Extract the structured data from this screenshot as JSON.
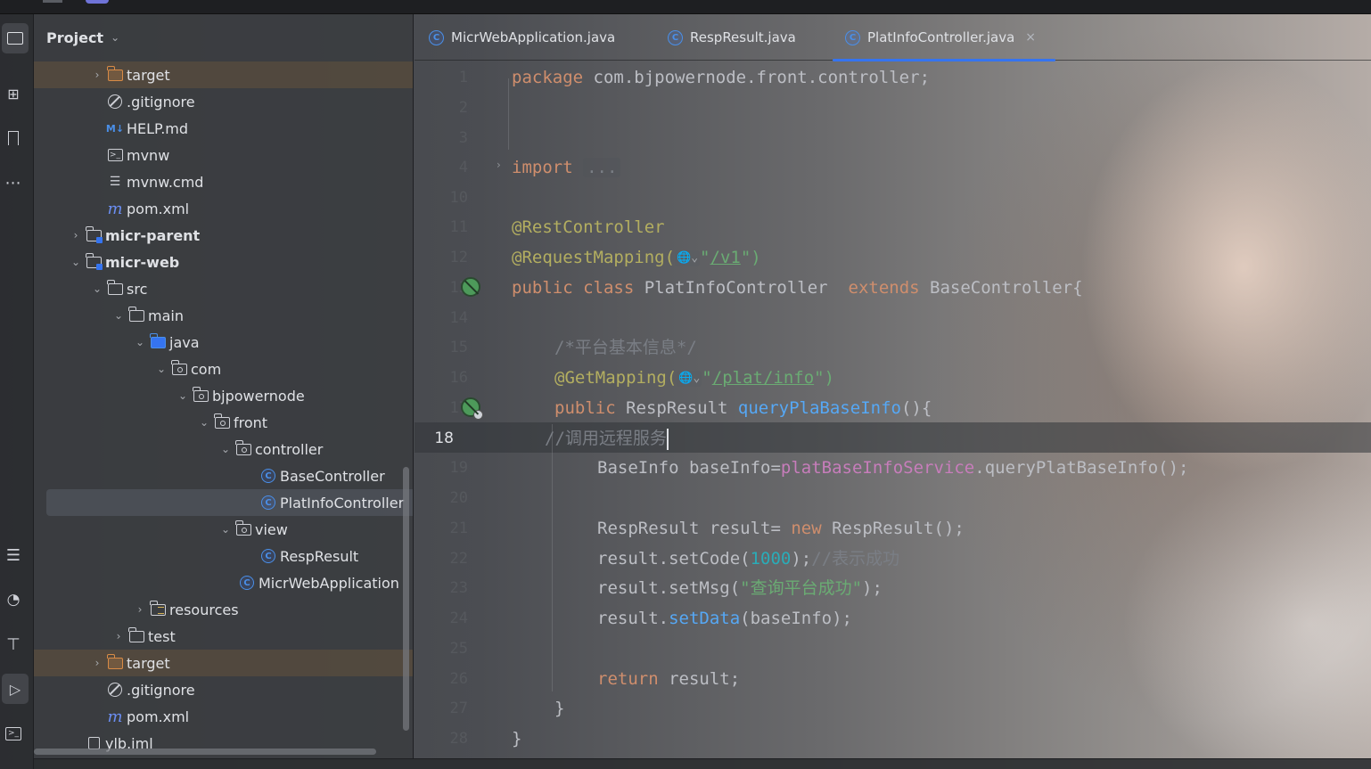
{
  "project_panel": {
    "title": "Project",
    "tree": [
      {
        "label": "target",
        "icon": "folder-excluded-icon"
      },
      {
        "label": ".gitignore",
        "icon": "ignore-file-icon"
      },
      {
        "label": "HELP.md",
        "icon": "markdown-icon"
      },
      {
        "label": "mvnw",
        "icon": "terminal-file-icon"
      },
      {
        "label": "mvnw.cmd",
        "icon": "text-file-icon"
      },
      {
        "label": "pom.xml",
        "icon": "maven-icon"
      },
      {
        "label": "micr-parent",
        "icon": "module-folder-icon"
      },
      {
        "label": "micr-web",
        "icon": "module-folder-icon"
      },
      {
        "label": "src",
        "icon": "folder-icon"
      },
      {
        "label": "main",
        "icon": "folder-icon"
      },
      {
        "label": "java",
        "icon": "source-folder-icon"
      },
      {
        "label": "com",
        "icon": "package-icon"
      },
      {
        "label": "bjpowernode",
        "icon": "package-icon"
      },
      {
        "label": "front",
        "icon": "package-icon"
      },
      {
        "label": "controller",
        "icon": "package-icon"
      },
      {
        "label": "BaseController",
        "icon": "class-icon"
      },
      {
        "label": "PlatInfoController",
        "icon": "class-icon"
      },
      {
        "label": "view",
        "icon": "package-icon"
      },
      {
        "label": "RespResult",
        "icon": "class-icon"
      },
      {
        "label": "MicrWebApplication",
        "icon": "spring-boot-class-icon"
      },
      {
        "label": "resources",
        "icon": "resources-folder-icon"
      },
      {
        "label": "test",
        "icon": "folder-icon"
      },
      {
        "label": "target",
        "icon": "folder-excluded-icon"
      },
      {
        "label": ".gitignore",
        "icon": "ignore-file-icon"
      },
      {
        "label": "pom.xml",
        "icon": "maven-icon"
      },
      {
        "label": "ylb.iml",
        "icon": "iml-file-icon"
      }
    ]
  },
  "tabs": [
    {
      "label": "MicrWebApplication.java",
      "icon": "spring-boot-class-icon"
    },
    {
      "label": "RespResult.java",
      "icon": "class-icon"
    },
    {
      "label": "PlatInfoController.java",
      "icon": "class-icon",
      "active": true,
      "close": "×"
    }
  ],
  "editor": {
    "current_line": "18",
    "line_numbers": [
      "1",
      "2",
      "3",
      "4",
      "10",
      "11",
      "12",
      "13",
      "14",
      "15",
      "16",
      "17",
      "18",
      "19",
      "20",
      "21",
      "22",
      "23",
      "24",
      "25",
      "26",
      "27",
      "28"
    ],
    "code": {
      "l1_kw": "package",
      "l1_rest": " com.bjpowernode.front.controller;",
      "l4_kw": "import",
      "l4_fold": "...",
      "l11_ann": "@RestController",
      "l12_ann": "@RequestMapping(",
      "l12_q1": "\"",
      "l12_link": "/v1",
      "l12_end": "\")",
      "l13_kw1": "public class",
      "l13_name": " PlatInfoController  ",
      "l13_kw2": "extends",
      "l13_rest": " BaseController{",
      "l15_cmt": "/*平台基本信息*/",
      "l16_ann": "@GetMapping(",
      "l16_q1": "\"",
      "l16_link": "/plat/info",
      "l16_end": "\")",
      "l17_kw": "public",
      "l17_type": " RespResult ",
      "l17_fn": "queryPlaBaseInfo",
      "l17_rest": "(){",
      "l18_cmt": "//调用远程服务",
      "l19_a": "BaseInfo baseInfo=",
      "l19_fld": "platBaseInfoService",
      "l19_b": ".queryPlatBaseInfo();",
      "l21_a": "RespResult result= ",
      "l21_kw": "new",
      "l21_b": " RespResult();",
      "l22_a": "result.setCode(",
      "l22_num": "1000",
      "l22_b": ");",
      "l22_cmt": "//表示成功",
      "l23_a": "result.setMsg(",
      "l23_str": "\"查询平台成功\"",
      "l23_b": ");",
      "l24_a": "result.",
      "l24_fn": "setData",
      "l24_b": "(baseInfo);",
      "l26_kw": "return",
      "l26_b": " result;",
      "l27": "}",
      "l28": "}"
    },
    "inlay_hint": "🌐⌄"
  },
  "colors": {
    "keyword": "#cf8e6d",
    "annotation": "#b3ae60",
    "string": "#6aab73",
    "comment": "#7a7e85",
    "method": "#56a8f5",
    "field": "#c77dbb",
    "number": "#2aacb8",
    "accent": "#3574f0"
  }
}
